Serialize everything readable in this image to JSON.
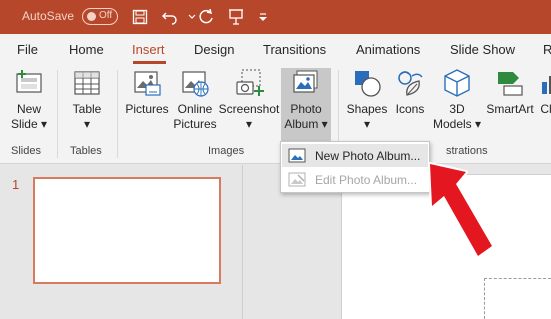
{
  "app": {
    "accent": "#b7472a"
  },
  "titlebar": {
    "autosave_label": "AutoSave",
    "autosave_state": "Off",
    "qat_icons": [
      "save-icon",
      "undo-icon",
      "redo-icon",
      "present-icon",
      "customize-icon"
    ]
  },
  "tabs": [
    "File",
    "Home",
    "Insert",
    "Design",
    "Transitions",
    "Animations",
    "Slide Show",
    "R"
  ],
  "active_tab": "Insert",
  "ribbon": {
    "new_slide": {
      "line1": "New",
      "line2": "Slide"
    },
    "table": "Table",
    "pictures": "Pictures",
    "online_pictures": {
      "line1": "Online",
      "line2": "Pictures"
    },
    "screenshot": "Screenshot",
    "photo_album": {
      "line1": "Photo",
      "line2": "Album"
    },
    "shapes": "Shapes",
    "icons": "Icons",
    "models_3d": {
      "line1": "3D",
      "line2": "Models"
    },
    "smartart": "SmartArt",
    "chart_partial": "Ch",
    "groups": {
      "slides": "Slides",
      "tables": "Tables",
      "images": "Images",
      "illustrations": "strations"
    }
  },
  "menu": {
    "items": [
      {
        "label": "New Photo Album...",
        "state": "highlighted",
        "icon": "photo-album-icon"
      },
      {
        "label": "Edit Photo Album...",
        "state": "disabled",
        "icon": "edit-photo-album-icon"
      }
    ]
  },
  "slides": {
    "current_number": "1"
  },
  "annotation": {
    "arrow_color": "#e4161f"
  }
}
